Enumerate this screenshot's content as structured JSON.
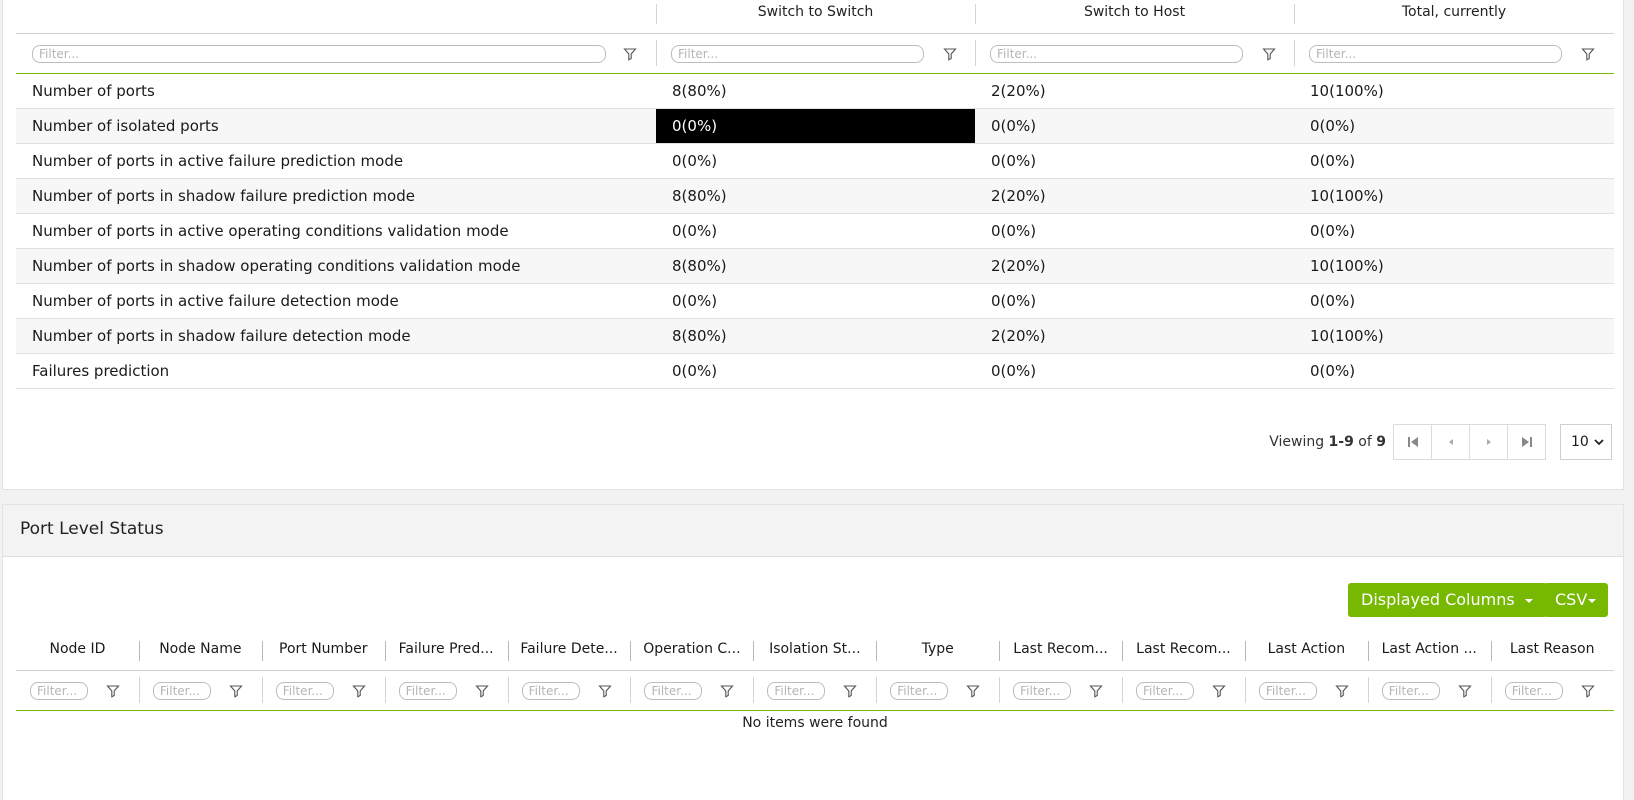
{
  "summary": {
    "headers": [
      "",
      "Switch to Switch",
      "Switch to Host",
      "Total, currently"
    ],
    "filter_placeholder": "Filter...",
    "rows": [
      [
        "Number of ports",
        "8(80%)",
        "2(20%)",
        "10(100%)"
      ],
      [
        "Number of isolated ports",
        "0(0%)",
        "0(0%)",
        "0(0%)"
      ],
      [
        "Number of ports in active failure prediction mode",
        "0(0%)",
        "0(0%)",
        "0(0%)"
      ],
      [
        "Number of ports in shadow failure prediction mode",
        "8(80%)",
        "2(20%)",
        "10(100%)"
      ],
      [
        "Number of ports in active operating conditions validation mode",
        "0(0%)",
        "0(0%)",
        "0(0%)"
      ],
      [
        "Number of ports in shadow operating conditions validation mode",
        "8(80%)",
        "2(20%)",
        "10(100%)"
      ],
      [
        "Number of ports in active failure detection mode",
        "0(0%)",
        "0(0%)",
        "0(0%)"
      ],
      [
        "Number of ports in shadow failure detection mode",
        "8(80%)",
        "2(20%)",
        "10(100%)"
      ],
      [
        "Failures prediction",
        "0(0%)",
        "0(0%)",
        "0(0%)"
      ]
    ],
    "pager": {
      "viewing": "Viewing",
      "range": "1-9",
      "of": "of",
      "total": "9",
      "page_size": "10"
    }
  },
  "port_level": {
    "title": "Port Level Status",
    "displayed_columns_label": "Displayed Columns",
    "csv_label": "CSV",
    "headers": [
      "Node ID",
      "Node Name",
      "Port Number",
      "Failure Pred...",
      "Failure Dete...",
      "Operation C...",
      "Isolation St...",
      "Type",
      "Last Recom...",
      "Last Recom...",
      "Last Action",
      "Last Action ...",
      "Last Reason"
    ],
    "filter_placeholder": "Filter...",
    "empty_message": "No items were found"
  },
  "colors": {
    "accent": "#76b900",
    "highlight_cell": "#000000"
  }
}
